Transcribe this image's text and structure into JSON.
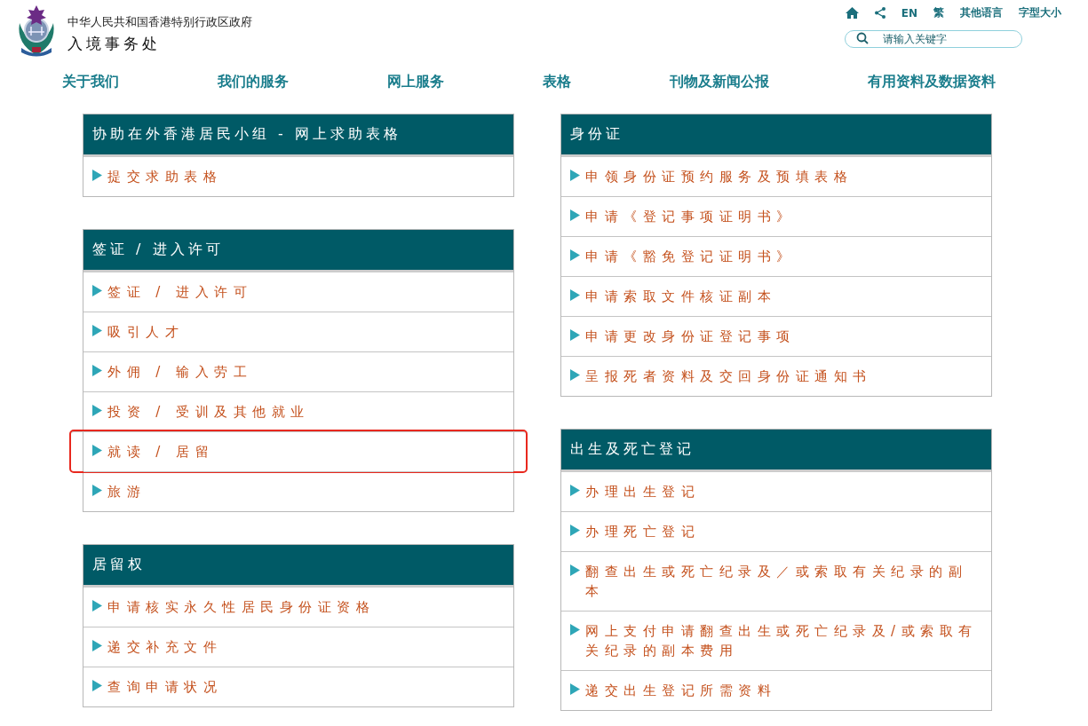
{
  "header": {
    "government": "中华人民共和国香港特别行政区政府",
    "department": "入境事务处"
  },
  "utility_links": [
    {
      "kind": "home"
    },
    {
      "kind": "share"
    },
    {
      "kind": "text",
      "label": "EN"
    },
    {
      "kind": "text",
      "label": "繁"
    },
    {
      "kind": "text",
      "label": "其他语言"
    },
    {
      "kind": "text",
      "label": "字型大小"
    }
  ],
  "search": {
    "placeholder": "请输入关键字"
  },
  "nav": [
    "关于我们",
    "我们的服务",
    "网上服务",
    "表格",
    "刊物及新闻公报",
    "有用资料及数据资料"
  ],
  "columns": [
    [
      {
        "title": "协助在外香港居民小组 - 网上求助表格",
        "items": [
          {
            "label": "提交求助表格",
            "highlighted": false
          }
        ]
      },
      {
        "title": "签证 / 进入许可",
        "items": [
          {
            "label": "签证 / 进入许可",
            "highlighted": false
          },
          {
            "label": "吸引人才",
            "highlighted": false
          },
          {
            "label": "外佣 / 输入劳工",
            "highlighted": false
          },
          {
            "label": "投资 / 受训及其他就业",
            "highlighted": false
          },
          {
            "label": "就读 / 居留",
            "highlighted": true
          },
          {
            "label": "旅游",
            "highlighted": false
          }
        ]
      },
      {
        "title": "居留权",
        "items": [
          {
            "label": "申请核实永久性居民身份证资格",
            "highlighted": false
          },
          {
            "label": "递交补充文件",
            "highlighted": false
          },
          {
            "label": "查询申请状况",
            "highlighted": false
          }
        ]
      }
    ],
    [
      {
        "title": "身份证",
        "items": [
          {
            "label": "申领身份证预约服务及预填表格",
            "highlighted": false
          },
          {
            "label": "申请《登记事项证明书》",
            "highlighted": false
          },
          {
            "label": "申请《豁免登记证明书》",
            "highlighted": false
          },
          {
            "label": "申请索取文件核证副本",
            "highlighted": false
          },
          {
            "label": "申请更改身份证登记事项",
            "highlighted": false
          },
          {
            "label": "呈报死者资料及交回身份证通知书",
            "highlighted": false
          }
        ]
      },
      {
        "title": "出生及死亡登记",
        "items": [
          {
            "label": "办理出生登记",
            "highlighted": false
          },
          {
            "label": "办理死亡登记",
            "highlighted": false
          },
          {
            "label": "翻查出生或死亡纪录及／或索取有关纪录的副本",
            "highlighted": false
          },
          {
            "label": "网上支付申请翻查出生或死亡纪录及/或索取有关纪录的副本费用",
            "highlighted": false
          },
          {
            "label": "递交出生登记所需资料",
            "highlighted": false
          }
        ]
      }
    ]
  ]
}
